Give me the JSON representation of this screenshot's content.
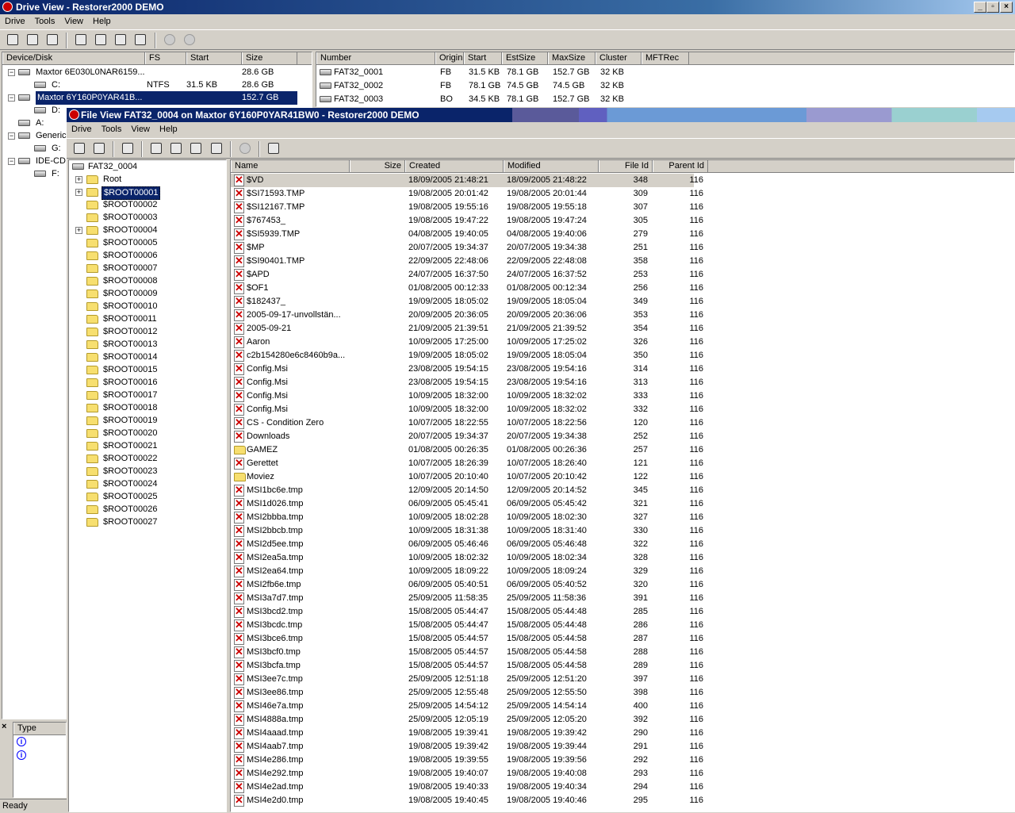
{
  "drive_view": {
    "title": "Drive View - Restorer2000 DEMO",
    "menu": [
      "Drive",
      "Tools",
      "View",
      "Help"
    ],
    "disk_columns": [
      "Device/Disk",
      "FS",
      "Start",
      "Size"
    ],
    "disks": [
      {
        "name": "Maxtor 6E030L0NAR6159...",
        "fs": "",
        "start": "",
        "size": "28.6 GB",
        "indent": 0
      },
      {
        "name": "C:",
        "fs": "NTFS",
        "start": "31.5 KB",
        "size": "28.6 GB",
        "indent": 1
      },
      {
        "name": "Maxtor 6Y160P0YAR41B...",
        "fs": "",
        "start": "",
        "size": "152.7 GB",
        "indent": 0,
        "selected": true
      },
      {
        "name": "D:",
        "fs": "",
        "start": "",
        "size": "",
        "indent": 1
      },
      {
        "name": "A:",
        "fs": "",
        "start": "",
        "size": "",
        "indent": 0
      },
      {
        "name": "Generic",
        "fs": "",
        "start": "",
        "size": "",
        "indent": 0
      },
      {
        "name": "G:",
        "fs": "",
        "start": "",
        "size": "",
        "indent": 1
      },
      {
        "name": "IDE-CD",
        "fs": "",
        "start": "",
        "size": "",
        "indent": 0
      },
      {
        "name": "F:",
        "fs": "",
        "start": "",
        "size": "",
        "indent": 1
      }
    ],
    "partition_columns": [
      "Number",
      "Origin",
      "Start",
      "EstSize",
      "MaxSize",
      "Cluster",
      "MFTRec"
    ],
    "partitions": [
      {
        "number": "FAT32_0001",
        "origin": "FB",
        "start": "31.5 KB",
        "estsize": "78.1 GB",
        "maxsize": "152.7 GB",
        "cluster": "32 KB",
        "mftrec": ""
      },
      {
        "number": "FAT32_0002",
        "origin": "FB",
        "start": "78.1 GB",
        "estsize": "74.5 GB",
        "maxsize": "74.5 GB",
        "cluster": "32 KB",
        "mftrec": ""
      },
      {
        "number": "FAT32_0003",
        "origin": "BO",
        "start": "34.5 KB",
        "estsize": "78.1 GB",
        "maxsize": "152.7 GB",
        "cluster": "32 KB",
        "mftrec": ""
      }
    ],
    "log_header": "Type",
    "status": "Ready"
  },
  "file_view": {
    "title": "File View FAT32_0004 on Maxtor 6Y160P0YAR41BW0 - Restorer2000 DEMO",
    "menu": [
      "Drive",
      "Tools",
      "View",
      "Help"
    ],
    "tree_root": "FAT32_0004",
    "tree": [
      "Root",
      "$ROOT00001",
      "$ROOT00002",
      "$ROOT00003",
      "$ROOT00004",
      "$ROOT00005",
      "$ROOT00006",
      "$ROOT00007",
      "$ROOT00008",
      "$ROOT00009",
      "$ROOT00010",
      "$ROOT00011",
      "$ROOT00012",
      "$ROOT00013",
      "$ROOT00014",
      "$ROOT00015",
      "$ROOT00016",
      "$ROOT00017",
      "$ROOT00018",
      "$ROOT00019",
      "$ROOT00020",
      "$ROOT00021",
      "$ROOT00022",
      "$ROOT00023",
      "$ROOT00024",
      "$ROOT00025",
      "$ROOT00026",
      "$ROOT00027"
    ],
    "tree_expandable": [
      "Root",
      "$ROOT00001",
      "$ROOT00004"
    ],
    "tree_selected": "$ROOT00001",
    "file_columns": [
      "Name",
      "Size",
      "Created",
      "Modified",
      "File Id",
      "Parent Id"
    ],
    "files": [
      [
        "$VD",
        "",
        "18/09/2005 21:48:21",
        "18/09/2005 21:48:22",
        "348",
        "116"
      ],
      [
        "$SI71593.TMP",
        "",
        "19/08/2005 20:01:42",
        "19/08/2005 20:01:44",
        "309",
        "116"
      ],
      [
        "$SI12167.TMP",
        "",
        "19/08/2005 19:55:16",
        "19/08/2005 19:55:18",
        "307",
        "116"
      ],
      [
        "$767453_",
        "",
        "19/08/2005 19:47:22",
        "19/08/2005 19:47:24",
        "305",
        "116"
      ],
      [
        "$SI5939.TMP",
        "",
        "04/08/2005 19:40:05",
        "04/08/2005 19:40:06",
        "279",
        "116"
      ],
      [
        "$MP",
        "",
        "20/07/2005 19:34:37",
        "20/07/2005 19:34:38",
        "251",
        "116"
      ],
      [
        "$SI90401.TMP",
        "",
        "22/09/2005 22:48:06",
        "22/09/2005 22:48:08",
        "358",
        "116"
      ],
      [
        "$APD",
        "",
        "24/07/2005 16:37:50",
        "24/07/2005 16:37:52",
        "253",
        "116"
      ],
      [
        "$OF1",
        "",
        "01/08/2005 00:12:33",
        "01/08/2005 00:12:34",
        "256",
        "116"
      ],
      [
        "$182437_",
        "",
        "19/09/2005 18:05:02",
        "19/09/2005 18:05:04",
        "349",
        "116"
      ],
      [
        "2005-09-17-unvollstän...",
        "",
        "20/09/2005 20:36:05",
        "20/09/2005 20:36:06",
        "353",
        "116"
      ],
      [
        "2005-09-21",
        "",
        "21/09/2005 21:39:51",
        "21/09/2005 21:39:52",
        "354",
        "116"
      ],
      [
        "Aaron",
        "",
        "10/09/2005 17:25:00",
        "10/09/2005 17:25:02",
        "326",
        "116"
      ],
      [
        "c2b154280e6c8460b9a...",
        "",
        "19/09/2005 18:05:02",
        "19/09/2005 18:05:04",
        "350",
        "116"
      ],
      [
        "Config.Msi",
        "",
        "23/08/2005 19:54:15",
        "23/08/2005 19:54:16",
        "314",
        "116"
      ],
      [
        "Config.Msi",
        "",
        "23/08/2005 19:54:15",
        "23/08/2005 19:54:16",
        "313",
        "116"
      ],
      [
        "Config.Msi",
        "",
        "10/09/2005 18:32:00",
        "10/09/2005 18:32:02",
        "333",
        "116"
      ],
      [
        "Config.Msi",
        "",
        "10/09/2005 18:32:00",
        "10/09/2005 18:32:02",
        "332",
        "116"
      ],
      [
        "CS - Condition Zero",
        "",
        "10/07/2005 18:22:55",
        "10/07/2005 18:22:56",
        "120",
        "116"
      ],
      [
        "Downloads",
        "",
        "20/07/2005 19:34:37",
        "20/07/2005 19:34:38",
        "252",
        "116"
      ],
      [
        "GAMEZ",
        "",
        "01/08/2005 00:26:35",
        "01/08/2005 00:26:36",
        "257",
        "116"
      ],
      [
        "Gerettet",
        "",
        "10/07/2005 18:26:39",
        "10/07/2005 18:26:40",
        "121",
        "116"
      ],
      [
        "Moviez",
        "",
        "10/07/2005 20:10:40",
        "10/07/2005 20:10:42",
        "122",
        "116"
      ],
      [
        "MSI1bc6e.tmp",
        "",
        "12/09/2005 20:14:50",
        "12/09/2005 20:14:52",
        "345",
        "116"
      ],
      [
        "MSI1d026.tmp",
        "",
        "06/09/2005 05:45:41",
        "06/09/2005 05:45:42",
        "321",
        "116"
      ],
      [
        "MSI2bbba.tmp",
        "",
        "10/09/2005 18:02:28",
        "10/09/2005 18:02:30",
        "327",
        "116"
      ],
      [
        "MSI2bbcb.tmp",
        "",
        "10/09/2005 18:31:38",
        "10/09/2005 18:31:40",
        "330",
        "116"
      ],
      [
        "MSI2d5ee.tmp",
        "",
        "06/09/2005 05:46:46",
        "06/09/2005 05:46:48",
        "322",
        "116"
      ],
      [
        "MSI2ea5a.tmp",
        "",
        "10/09/2005 18:02:32",
        "10/09/2005 18:02:34",
        "328",
        "116"
      ],
      [
        "MSI2ea64.tmp",
        "",
        "10/09/2005 18:09:22",
        "10/09/2005 18:09:24",
        "329",
        "116"
      ],
      [
        "MSI2fb6e.tmp",
        "",
        "06/09/2005 05:40:51",
        "06/09/2005 05:40:52",
        "320",
        "116"
      ],
      [
        "MSI3a7d7.tmp",
        "",
        "25/09/2005 11:58:35",
        "25/09/2005 11:58:36",
        "391",
        "116"
      ],
      [
        "MSI3bcd2.tmp",
        "",
        "15/08/2005 05:44:47",
        "15/08/2005 05:44:48",
        "285",
        "116"
      ],
      [
        "MSI3bcdc.tmp",
        "",
        "15/08/2005 05:44:47",
        "15/08/2005 05:44:48",
        "286",
        "116"
      ],
      [
        "MSI3bce6.tmp",
        "",
        "15/08/2005 05:44:57",
        "15/08/2005 05:44:58",
        "287",
        "116"
      ],
      [
        "MSI3bcf0.tmp",
        "",
        "15/08/2005 05:44:57",
        "15/08/2005 05:44:58",
        "288",
        "116"
      ],
      [
        "MSI3bcfa.tmp",
        "",
        "15/08/2005 05:44:57",
        "15/08/2005 05:44:58",
        "289",
        "116"
      ],
      [
        "MSI3ee7c.tmp",
        "",
        "25/09/2005 12:51:18",
        "25/09/2005 12:51:20",
        "397",
        "116"
      ],
      [
        "MSI3ee86.tmp",
        "",
        "25/09/2005 12:55:48",
        "25/09/2005 12:55:50",
        "398",
        "116"
      ],
      [
        "MSI46e7a.tmp",
        "",
        "25/09/2005 14:54:12",
        "25/09/2005 14:54:14",
        "400",
        "116"
      ],
      [
        "MSI4888a.tmp",
        "",
        "25/09/2005 12:05:19",
        "25/09/2005 12:05:20",
        "392",
        "116"
      ],
      [
        "MSI4aaad.tmp",
        "",
        "19/08/2005 19:39:41",
        "19/08/2005 19:39:42",
        "290",
        "116"
      ],
      [
        "MSI4aab7.tmp",
        "",
        "19/08/2005 19:39:42",
        "19/08/2005 19:39:44",
        "291",
        "116"
      ],
      [
        "MSI4e286.tmp",
        "",
        "19/08/2005 19:39:55",
        "19/08/2005 19:39:56",
        "292",
        "116"
      ],
      [
        "MSI4e292.tmp",
        "",
        "19/08/2005 19:40:07",
        "19/08/2005 19:40:08",
        "293",
        "116"
      ],
      [
        "MSI4e2ad.tmp",
        "",
        "19/08/2005 19:40:33",
        "19/08/2005 19:40:34",
        "294",
        "116"
      ],
      [
        "MSI4e2d0.tmp",
        "",
        "19/08/2005 19:40:45",
        "19/08/2005 19:40:46",
        "295",
        "116"
      ]
    ],
    "folder_names": [
      "GAMEZ",
      "Moviez"
    ]
  }
}
